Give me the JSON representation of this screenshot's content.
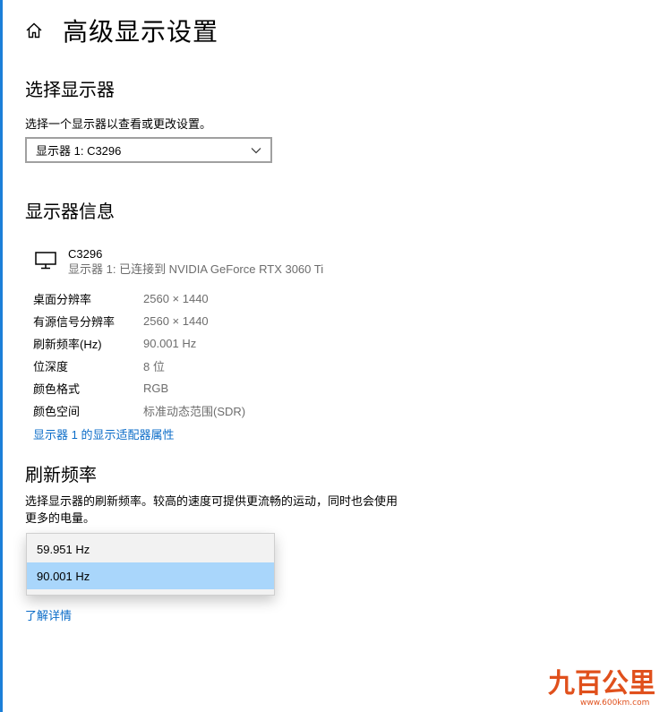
{
  "header": {
    "title": "高级显示设置",
    "home_icon": "home-icon"
  },
  "select_display": {
    "title": "选择显示器",
    "description": "选择一个显示器以查看或更改设置。",
    "selected": "显示器 1: C3296"
  },
  "display_info": {
    "title": "显示器信息",
    "monitor_name": "C3296",
    "monitor_connection": "显示器 1: 已连接到 NVIDIA GeForce RTX 3060 Ti",
    "rows": [
      {
        "label": "桌面分辨率",
        "value": "2560 × 1440"
      },
      {
        "label": "有源信号分辨率",
        "value": "2560 × 1440"
      },
      {
        "label": "刷新频率(Hz)",
        "value": "90.001 Hz"
      },
      {
        "label": "位深度",
        "value": "8 位"
      },
      {
        "label": "颜色格式",
        "value": "RGB"
      },
      {
        "label": "颜色空间",
        "value": "标准动态范围(SDR)"
      }
    ],
    "adapter_link": "显示器 1 的显示适配器属性"
  },
  "refresh_rate": {
    "title": "刷新频率",
    "description_line1": "选择显示器的刷新频率。较高的速度可提供更流畅的运动，同时也会使用",
    "description_line2": "更多的电量。",
    "options": [
      "59.951 Hz",
      "90.001 Hz"
    ],
    "selected": "90.001 Hz",
    "learn_more": "了解详情"
  },
  "watermark": {
    "text": "九百公里",
    "url": "www.600km.com"
  },
  "colors": {
    "accent": "#0b6cc8",
    "selected_bg": "#a9d6fb",
    "watermark": "#e0501c"
  }
}
